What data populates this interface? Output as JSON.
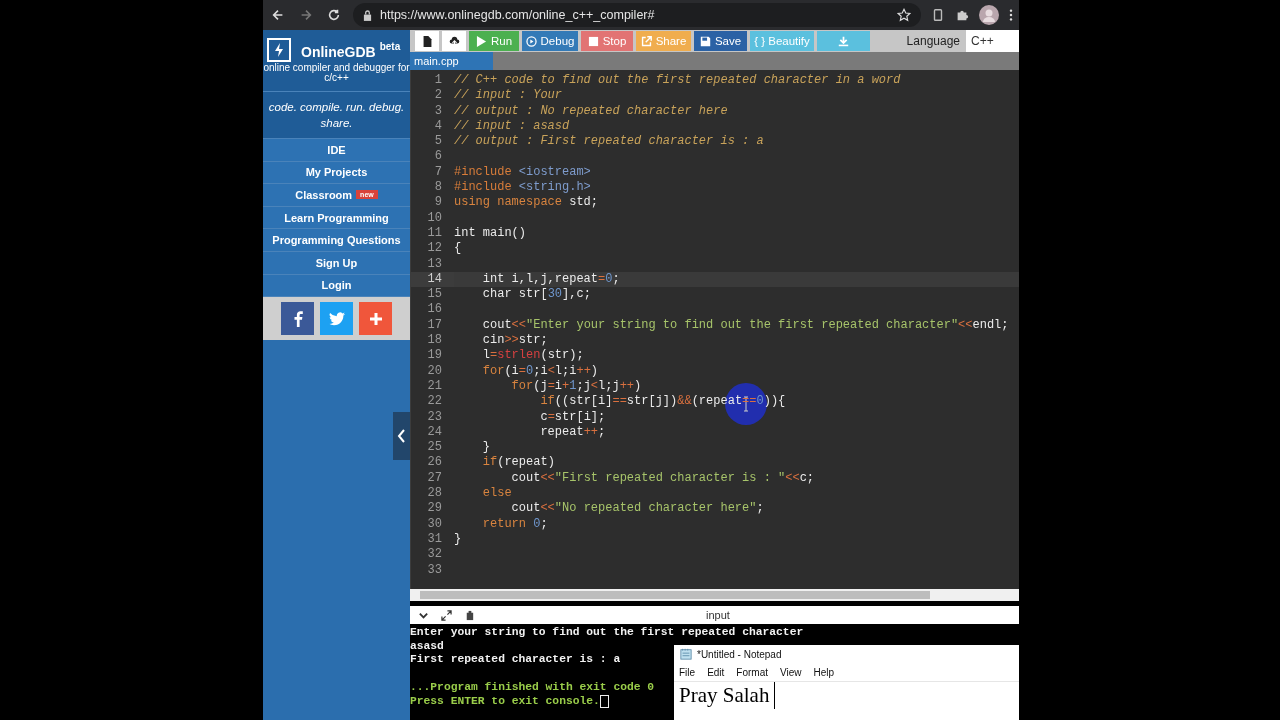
{
  "browser": {
    "url": "https://www.onlinegdb.com/online_c++_compiler#"
  },
  "sidebar": {
    "brand": "OnlineGDB",
    "brand_tag": "beta",
    "tagline": "online compiler and debugger for c/c++",
    "motto": "code. compile. run. debug. share.",
    "nav": [
      {
        "label": "IDE"
      },
      {
        "label": "My Projects"
      },
      {
        "label": "Classroom",
        "badge": "new"
      },
      {
        "label": "Learn Programming"
      },
      {
        "label": "Programming Questions"
      },
      {
        "label": "Sign Up"
      },
      {
        "label": "Login"
      }
    ],
    "social": [
      {
        "kind": "facebook"
      },
      {
        "kind": "twitter"
      },
      {
        "kind": "more"
      }
    ]
  },
  "toolbar": {
    "buttons": [
      {
        "kind": "new-file"
      },
      {
        "kind": "upload"
      },
      {
        "kind": "run",
        "label": "Run"
      },
      {
        "kind": "debug",
        "label": "Debug"
      },
      {
        "kind": "stop",
        "label": "Stop"
      },
      {
        "kind": "share",
        "label": "Share"
      },
      {
        "kind": "save",
        "label": "Save"
      },
      {
        "kind": "beautify",
        "label": "{ } Beautify"
      },
      {
        "kind": "download"
      }
    ],
    "language_label": "Language",
    "language": "C++"
  },
  "editor": {
    "tabs": [
      {
        "label": "main.cpp",
        "selected": true
      }
    ],
    "lines": [
      {
        "number": "1",
        "current": false,
        "tokens": [
          {
            "kind": "c",
            "text": "// C++ code to find out the first repeated character in a word"
          }
        ]
      },
      {
        "number": "2",
        "current": false,
        "tokens": [
          {
            "kind": "c",
            "text": "// input : Your"
          }
        ]
      },
      {
        "number": "3",
        "current": false,
        "tokens": [
          {
            "kind": "c",
            "text": "// output : No repeated character here"
          }
        ]
      },
      {
        "number": "4",
        "current": false,
        "tokens": [
          {
            "kind": "c",
            "text": "// input : asasd"
          }
        ]
      },
      {
        "number": "5",
        "current": false,
        "tokens": [
          {
            "kind": "c",
            "text": "// output : First repeated character is : a"
          }
        ]
      },
      {
        "number": "6",
        "current": false
      },
      {
        "number": "7",
        "current": false,
        "tokens": [
          {
            "kind": "p",
            "text": "#include "
          },
          {
            "kind": "h",
            "text": "<iostream>"
          }
        ]
      },
      {
        "number": "8",
        "current": false,
        "tokens": [
          {
            "kind": "p",
            "text": "#include "
          },
          {
            "kind": "h",
            "text": "<string.h>"
          }
        ]
      },
      {
        "number": "9",
        "current": false,
        "tokens": [
          {
            "kind": "k",
            "text": "using namespace "
          },
          {
            "kind": "t",
            "text": "std;"
          }
        ]
      },
      {
        "number": "10",
        "current": false
      },
      {
        "number": "11",
        "current": false,
        "tokens": [
          {
            "kind": "t",
            "text": "int main()"
          }
        ]
      },
      {
        "number": "12",
        "current": false,
        "tokens": [
          {
            "kind": "t",
            "text": "{"
          }
        ]
      },
      {
        "number": "13",
        "current": false
      },
      {
        "number": "14",
        "current": true,
        "tokens": [
          {
            "kind": "t",
            "text": "    int i,l,j,repeat"
          },
          {
            "kind": "o",
            "text": "="
          },
          {
            "kind": "n",
            "text": "0"
          },
          {
            "kind": "t",
            "text": ";"
          }
        ]
      },
      {
        "number": "15",
        "current": false,
        "tokens": [
          {
            "kind": "t",
            "text": "    char str["
          },
          {
            "kind": "n",
            "text": "30"
          },
          {
            "kind": "t",
            "text": "],c;"
          }
        ]
      },
      {
        "number": "16",
        "current": false
      },
      {
        "number": "17",
        "current": false,
        "tokens": [
          {
            "kind": "t",
            "text": "    cout"
          },
          {
            "kind": "o",
            "text": "<<"
          },
          {
            "kind": "s",
            "text": "\"Enter your string to find out the first repeated character\""
          },
          {
            "kind": "o",
            "text": "<<"
          },
          {
            "kind": "t",
            "text": "endl;"
          }
        ]
      },
      {
        "number": "18",
        "current": false,
        "tokens": [
          {
            "kind": "t",
            "text": "    cin"
          },
          {
            "kind": "o",
            "text": ">>"
          },
          {
            "kind": "t",
            "text": "str;"
          }
        ]
      },
      {
        "number": "19",
        "current": false,
        "tokens": [
          {
            "kind": "t",
            "text": "    l"
          },
          {
            "kind": "o",
            "text": "="
          },
          {
            "kind": "f",
            "text": "strlen"
          },
          {
            "kind": "t",
            "text": "(str);"
          }
        ]
      },
      {
        "number": "20",
        "current": false,
        "tokens": [
          {
            "kind": "k",
            "text": "    for"
          },
          {
            "kind": "t",
            "text": "(i"
          },
          {
            "kind": "o",
            "text": "="
          },
          {
            "kind": "n",
            "text": "0"
          },
          {
            "kind": "t",
            "text": ";i"
          },
          {
            "kind": "o",
            "text": "<"
          },
          {
            "kind": "t",
            "text": "l;i"
          },
          {
            "kind": "o",
            "text": "++"
          },
          {
            "kind": "t",
            "text": ")"
          }
        ]
      },
      {
        "number": "21",
        "current": false,
        "tokens": [
          {
            "kind": "k",
            "text": "        for"
          },
          {
            "kind": "t",
            "text": "(j"
          },
          {
            "kind": "o",
            "text": "="
          },
          {
            "kind": "t",
            "text": "i"
          },
          {
            "kind": "o",
            "text": "+"
          },
          {
            "kind": "n",
            "text": "1"
          },
          {
            "kind": "t",
            "text": ";j"
          },
          {
            "kind": "o",
            "text": "<"
          },
          {
            "kind": "t",
            "text": "l;j"
          },
          {
            "kind": "o",
            "text": "++"
          },
          {
            "kind": "t",
            "text": ")"
          }
        ]
      },
      {
        "number": "22",
        "current": false,
        "tokens": [
          {
            "kind": "k",
            "text": "            if"
          },
          {
            "kind": "t",
            "text": "((str[i]"
          },
          {
            "kind": "o",
            "text": "=="
          },
          {
            "kind": "t",
            "text": "str[j])"
          },
          {
            "kind": "o",
            "text": "&&"
          },
          {
            "kind": "t",
            "text": "(repeat"
          },
          {
            "kind": "o",
            "text": "=="
          },
          {
            "kind": "n",
            "text": "0"
          },
          {
            "kind": "t",
            "text": ")){"
          }
        ]
      },
      {
        "number": "23",
        "current": false,
        "tokens": [
          {
            "kind": "t",
            "text": "            c"
          },
          {
            "kind": "o",
            "text": "="
          },
          {
            "kind": "t",
            "text": "str[i];"
          }
        ]
      },
      {
        "number": "24",
        "current": false,
        "tokens": [
          {
            "kind": "t",
            "text": "            repeat"
          },
          {
            "kind": "o",
            "text": "++"
          },
          {
            "kind": "t",
            "text": ";"
          }
        ]
      },
      {
        "number": "25",
        "current": false,
        "tokens": [
          {
            "kind": "t",
            "text": "    }"
          }
        ]
      },
      {
        "number": "26",
        "current": false,
        "tokens": [
          {
            "kind": "k",
            "text": "    if"
          },
          {
            "kind": "t",
            "text": "(repeat)"
          }
        ]
      },
      {
        "number": "27",
        "current": false,
        "tokens": [
          {
            "kind": "t",
            "text": "        cout"
          },
          {
            "kind": "o",
            "text": "<<"
          },
          {
            "kind": "s",
            "text": "\"First repeated character is : \""
          },
          {
            "kind": "o",
            "text": "<<"
          },
          {
            "kind": "t",
            "text": "c;"
          }
        ]
      },
      {
        "number": "28",
        "current": false,
        "tokens": [
          {
            "kind": "k",
            "text": "    else"
          }
        ]
      },
      {
        "number": "29",
        "current": false,
        "tokens": [
          {
            "kind": "t",
            "text": "        cout"
          },
          {
            "kind": "o",
            "text": "<<"
          },
          {
            "kind": "s",
            "text": "\"No repeated character here\""
          },
          {
            "kind": "t",
            "text": ";"
          }
        ]
      },
      {
        "number": "30",
        "current": false,
        "tokens": [
          {
            "kind": "k",
            "text": "    return "
          },
          {
            "kind": "n",
            "text": "0"
          },
          {
            "kind": "t",
            "text": ";"
          }
        ]
      },
      {
        "number": "31",
        "current": false,
        "tokens": [
          {
            "kind": "t",
            "text": "}"
          }
        ]
      },
      {
        "number": "32",
        "current": false
      },
      {
        "number": "33",
        "current": false
      }
    ]
  },
  "console": {
    "title": "input",
    "lines": [
      {
        "kind": "output",
        "text": "Enter your string to find out the first repeated character"
      },
      {
        "kind": "output",
        "text": "asasd"
      },
      {
        "kind": "output",
        "text": "First repeated character is : a"
      },
      {
        "kind": "blank"
      },
      {
        "kind": "status",
        "text": "...Program finished with exit code 0"
      },
      {
        "kind": "prompt",
        "text": "Press ENTER to exit console."
      }
    ]
  },
  "notepad": {
    "title": "*Untitled - Notepad",
    "menu": [
      "File",
      "Edit",
      "Format",
      "View",
      "Help"
    ],
    "text": "Pray Salah"
  }
}
